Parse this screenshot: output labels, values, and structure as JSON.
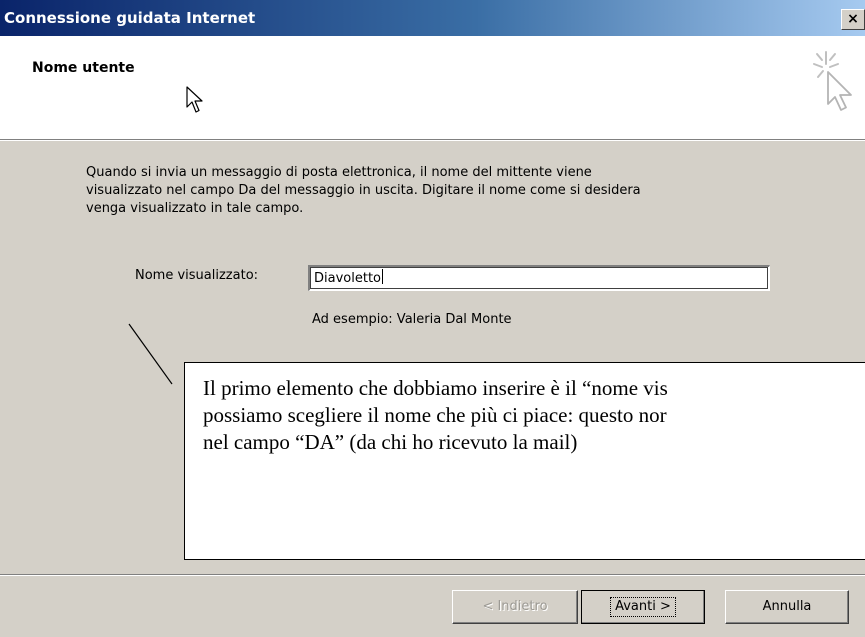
{
  "window": {
    "title": "Connessione guidata Internet",
    "close_label": "×"
  },
  "header": {
    "title": "Nome utente",
    "icon": "wizard-cursor-icon"
  },
  "main": {
    "description": "Quando si invia un messaggio di posta elettronica, il nome del mittente viene visualizzato nel campo Da del messaggio in uscita. Digitare il nome come si desidera venga visualizzato in tale campo.",
    "description_lines": [
      "Quando si invia un messaggio di posta elettronica, il nome del mittente viene",
      "visualizzato nel campo Da del messaggio in uscita. Digitare il nome come si desidera",
      "venga visualizzato in tale campo."
    ],
    "display_name_label": "Nome visualizzato:",
    "display_name_value": "Diavoletto",
    "example_text": "Ad esempio: Valeria Dal Monte"
  },
  "callout": {
    "lines": [
      "Il primo elemento che dobbiamo inserire è il “nome vis",
      "possiamo scegliere il nome che più ci piace: questo nor",
      "nel campo “DA” (da chi ho ricevuto la mail)"
    ]
  },
  "buttons": {
    "back": "< Indietro",
    "next": "Avanti >",
    "cancel": "Annulla"
  },
  "colors": {
    "titlebar_start": "#0a246a",
    "titlebar_end": "#a6caf0",
    "dialog_face": "#d4d0c8",
    "disabled_text": "#9c9a94"
  }
}
